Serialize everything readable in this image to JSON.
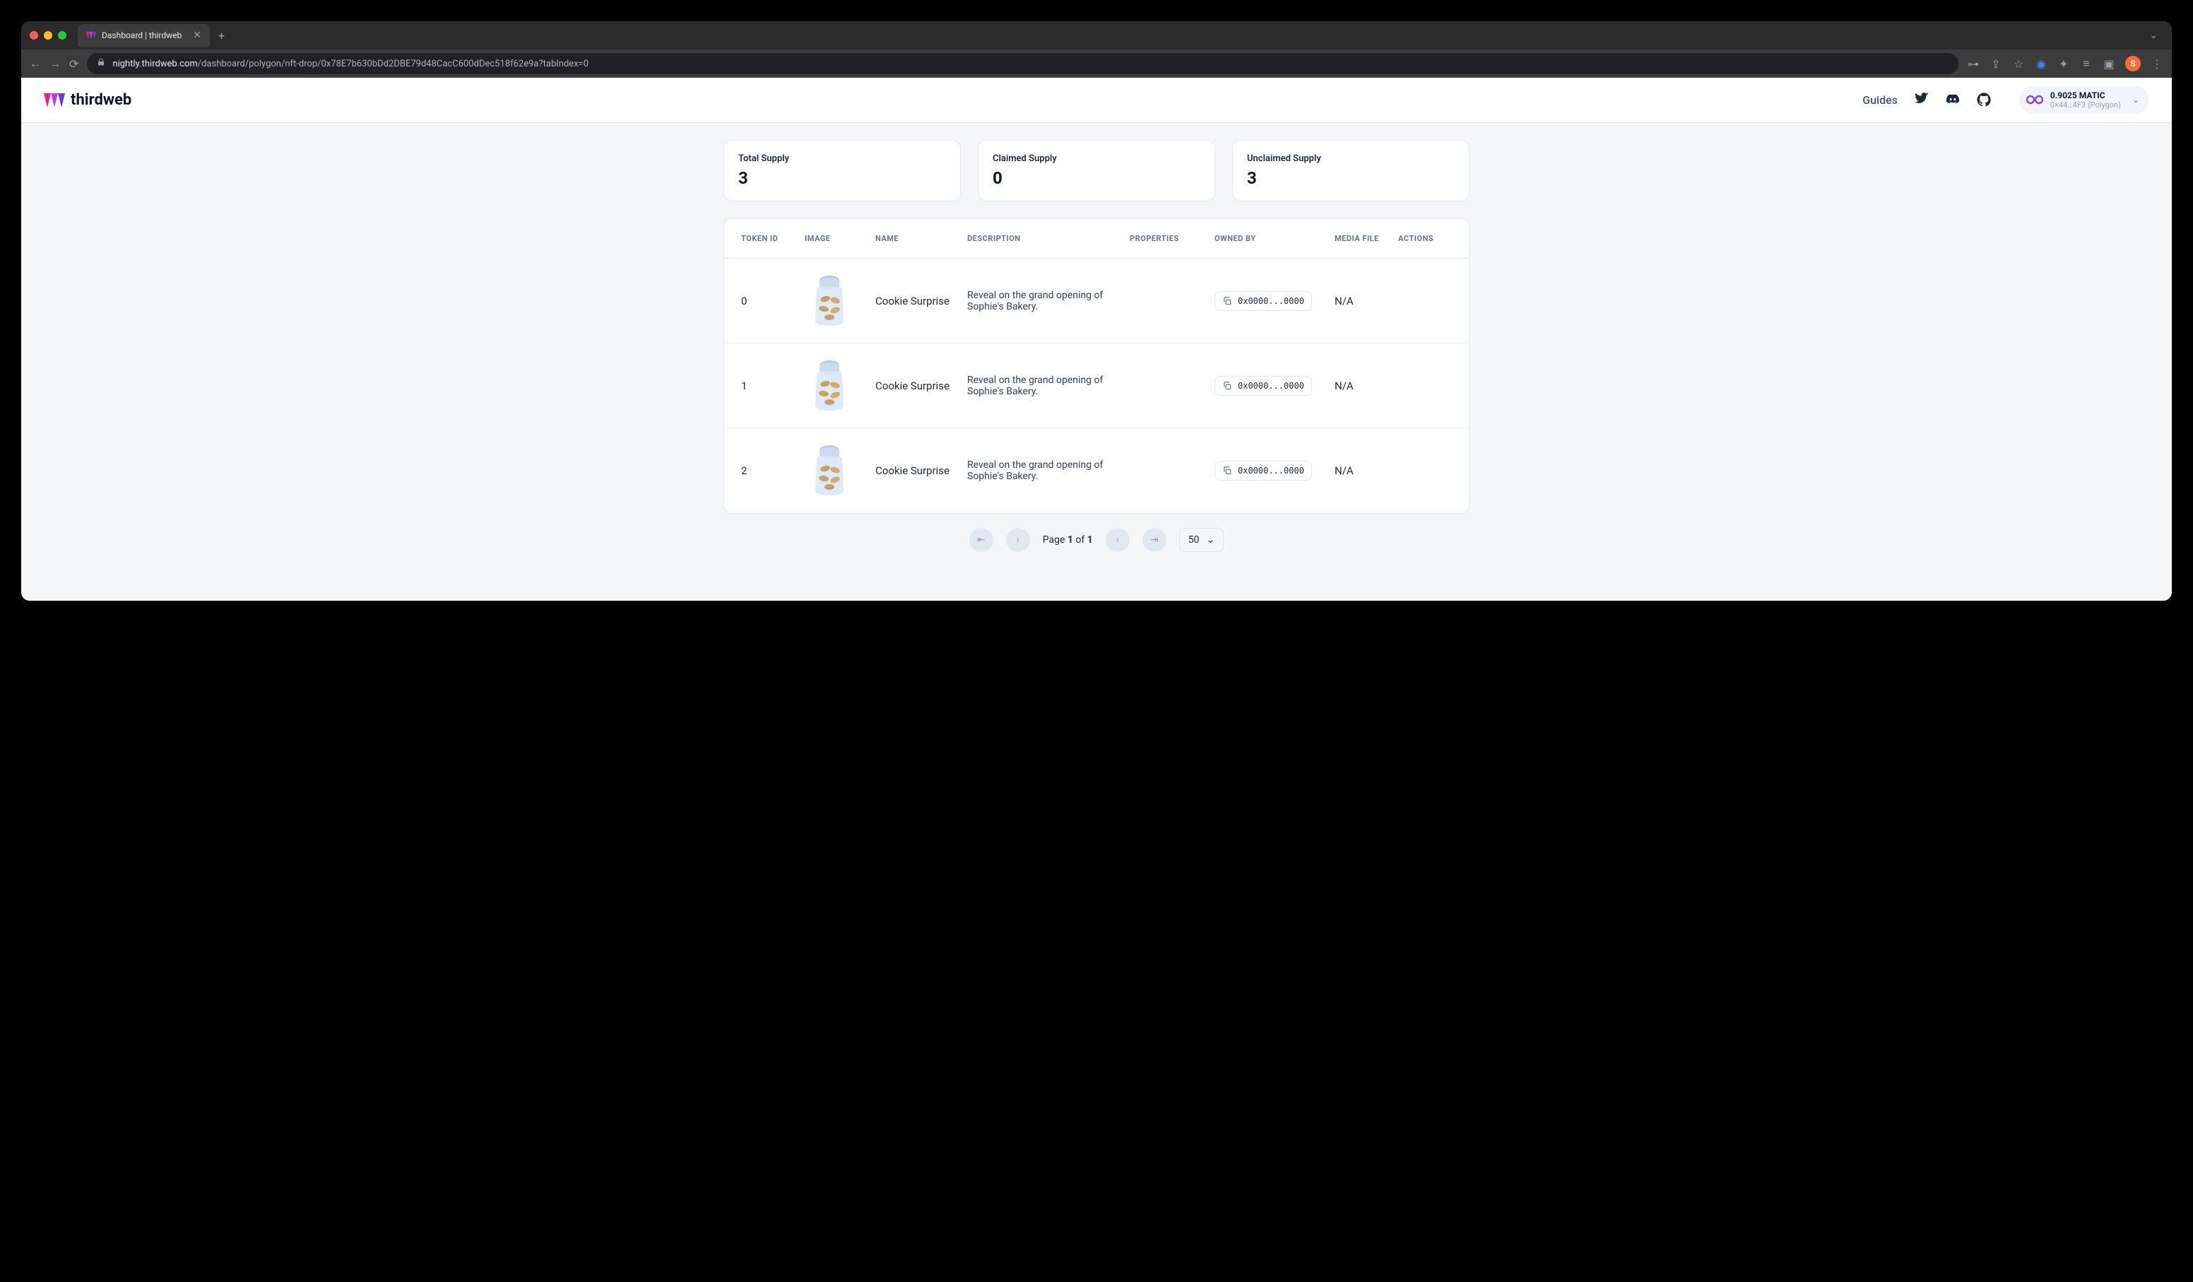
{
  "browser": {
    "tab_title": "Dashboard | thirdweb",
    "url_domain": "nightly.thirdweb.com",
    "url_path": "/dashboard/polygon/nft-drop/0x78E7b630bDd2DBE79d48CacC600dDec518f62e9a?tabIndex=0",
    "avatar_initial": "S"
  },
  "header": {
    "brand": "thirdweb",
    "guides": "Guides",
    "wallet_balance": "0.9025 MATIC",
    "wallet_address": "0×44…4F3 (Polygon)"
  },
  "stats": [
    {
      "label": "Total Supply",
      "value": "3"
    },
    {
      "label": "Claimed Supply",
      "value": "0"
    },
    {
      "label": "Unclaimed Supply",
      "value": "3"
    }
  ],
  "table": {
    "columns": {
      "token_id": "TOKEN ID",
      "image": "IMAGE",
      "name": "NAME",
      "description": "DESCRIPTION",
      "properties": "PROPERTIES",
      "owned_by": "OWNED BY",
      "media_file": "MEDIA FILE",
      "actions": "ACTIONS"
    },
    "rows": [
      {
        "token_id": "0",
        "name": "Cookie Surprise",
        "description": "Reveal on the grand opening of Sophie's Bakery.",
        "owned_by": "0x0000...0000",
        "media_file": "N/A"
      },
      {
        "token_id": "1",
        "name": "Cookie Surprise",
        "description": "Reveal on the grand opening of Sophie's Bakery.",
        "owned_by": "0x0000...0000",
        "media_file": "N/A"
      },
      {
        "token_id": "2",
        "name": "Cookie Surprise",
        "description": "Reveal on the grand opening of Sophie's Bakery.",
        "owned_by": "0x0000...0000",
        "media_file": "N/A"
      }
    ]
  },
  "pagination": {
    "label_prefix": "Page ",
    "current": "1",
    "separator": " of ",
    "total": "1",
    "page_size": "50"
  }
}
